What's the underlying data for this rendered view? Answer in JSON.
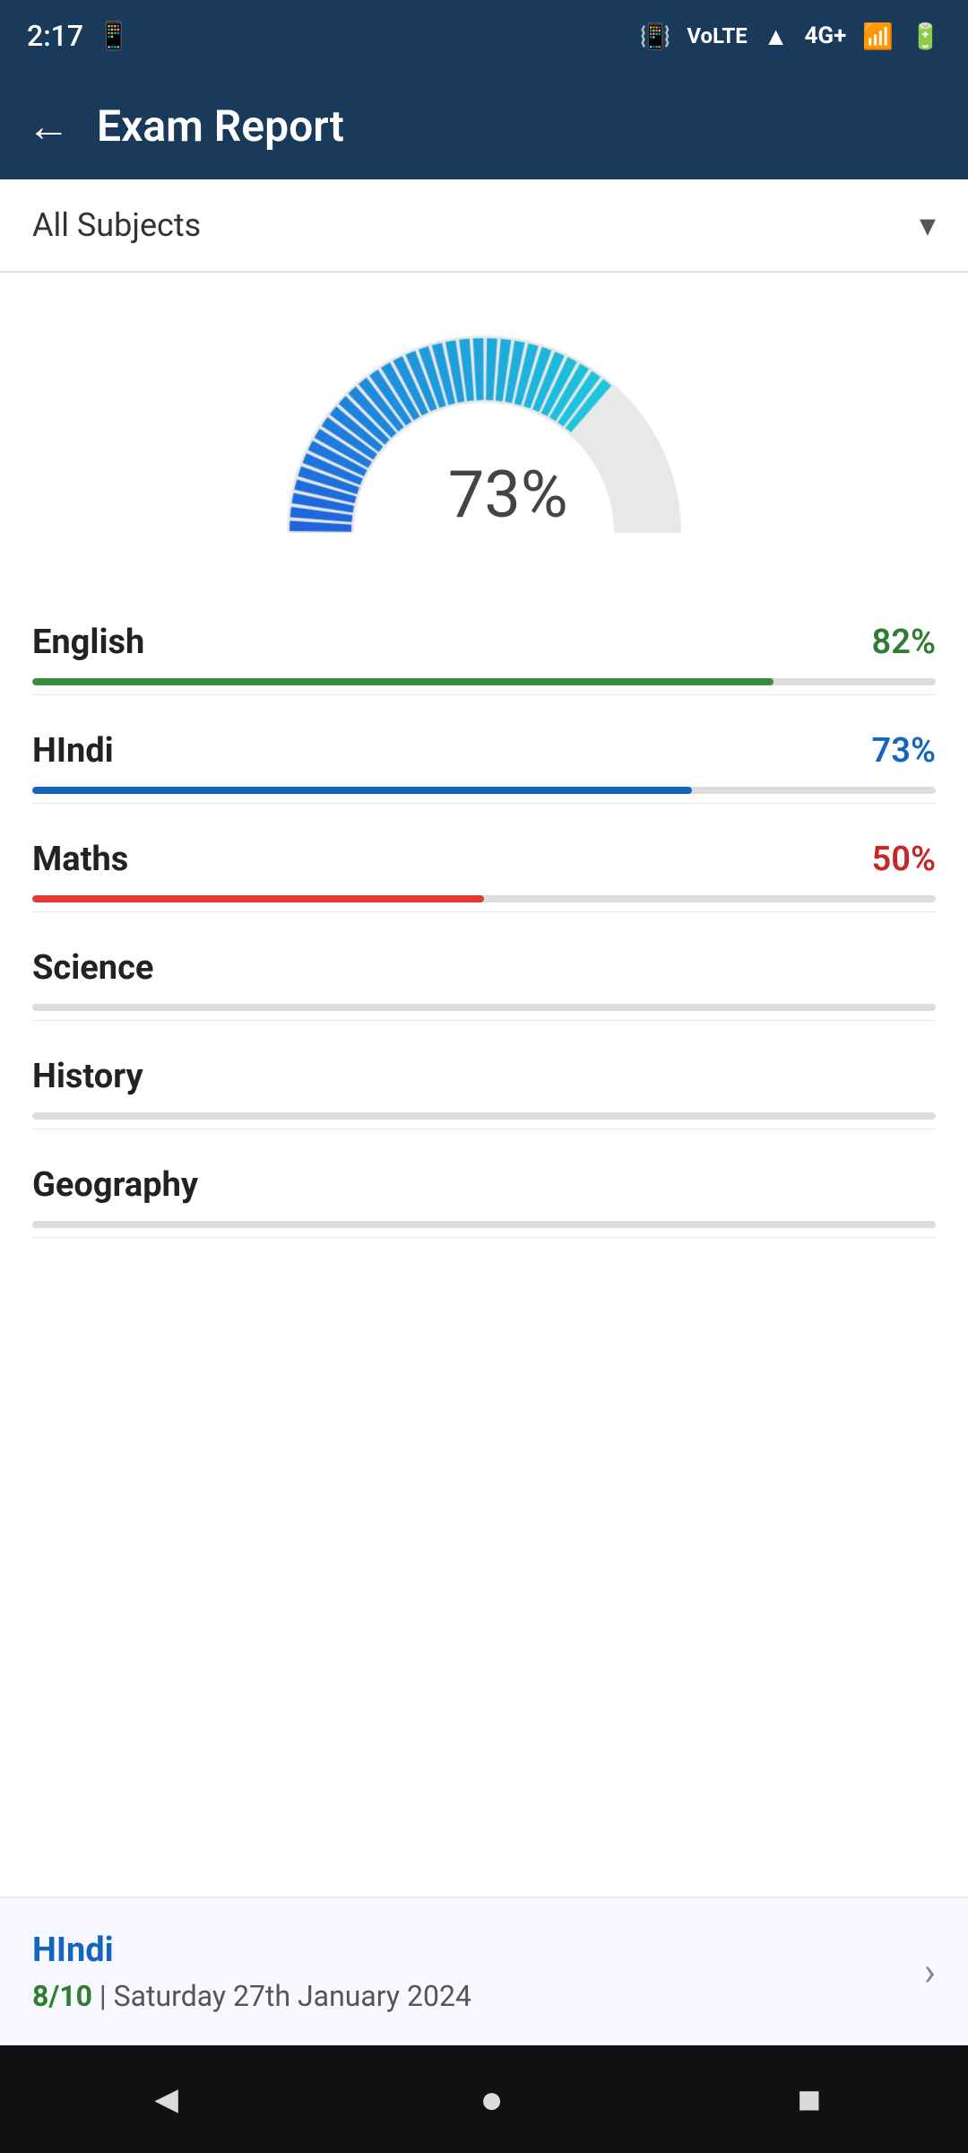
{
  "statusBar": {
    "time": "2:17",
    "icons": [
      "vibrate",
      "volte",
      "wifi",
      "4g",
      "signal",
      "battery"
    ]
  },
  "header": {
    "backLabel": "←",
    "title": "Exam Report"
  },
  "subjectDropdown": {
    "label": "All Subjects",
    "arrowIcon": "▾"
  },
  "gauge": {
    "value": "73%",
    "fillPercent": 73
  },
  "subjects": [
    {
      "name": "English",
      "pct": "82%",
      "fillPct": 82,
      "colorClass": "pct-green",
      "barClass": "fill-green"
    },
    {
      "name": "HIndi",
      "pct": "73%",
      "fillPct": 73,
      "colorClass": "pct-blue",
      "barClass": "fill-blue"
    },
    {
      "name": "Maths",
      "pct": "50%",
      "fillPct": 50,
      "colorClass": "pct-red",
      "barClass": "fill-red"
    },
    {
      "name": "Science",
      "pct": "",
      "fillPct": 0,
      "colorClass": "",
      "barClass": "fill-gray"
    },
    {
      "name": "History",
      "pct": "",
      "fillPct": 0,
      "colorClass": "",
      "barClass": "fill-gray"
    },
    {
      "name": "Geography",
      "pct": "",
      "fillPct": 0,
      "colorClass": "",
      "barClass": "fill-gray"
    }
  ],
  "recentExam": {
    "subject": "HIndi",
    "score": "8/10",
    "date": "Saturday 27th January 2024",
    "chevron": "›"
  },
  "navBar": {
    "back": "◄",
    "home": "●",
    "recent": "■"
  }
}
